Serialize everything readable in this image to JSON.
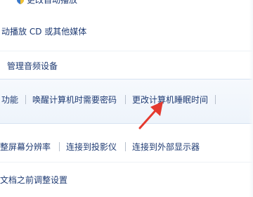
{
  "autoplay": {
    "top_partial_label": "更改自动播放",
    "media_label": "动播放 CD 或其他媒体"
  },
  "sound": {
    "manage_devices": "管理音频设备"
  },
  "power": {
    "item_function": "功能",
    "item_wake_password": "唤醒计算机时需要密码",
    "item_change_sleep": "更改计算机睡眠时间"
  },
  "display": {
    "item_resolution": "整屏幕分辨率",
    "item_projector": "连接到投影仪",
    "item_external": "连接到外部显示器"
  },
  "presentation": {
    "item_adjust": "文档之前调整设置"
  },
  "colors": {
    "link": "#1f3b73",
    "arrow": "#e53a2f",
    "band": "#eef4fb"
  }
}
